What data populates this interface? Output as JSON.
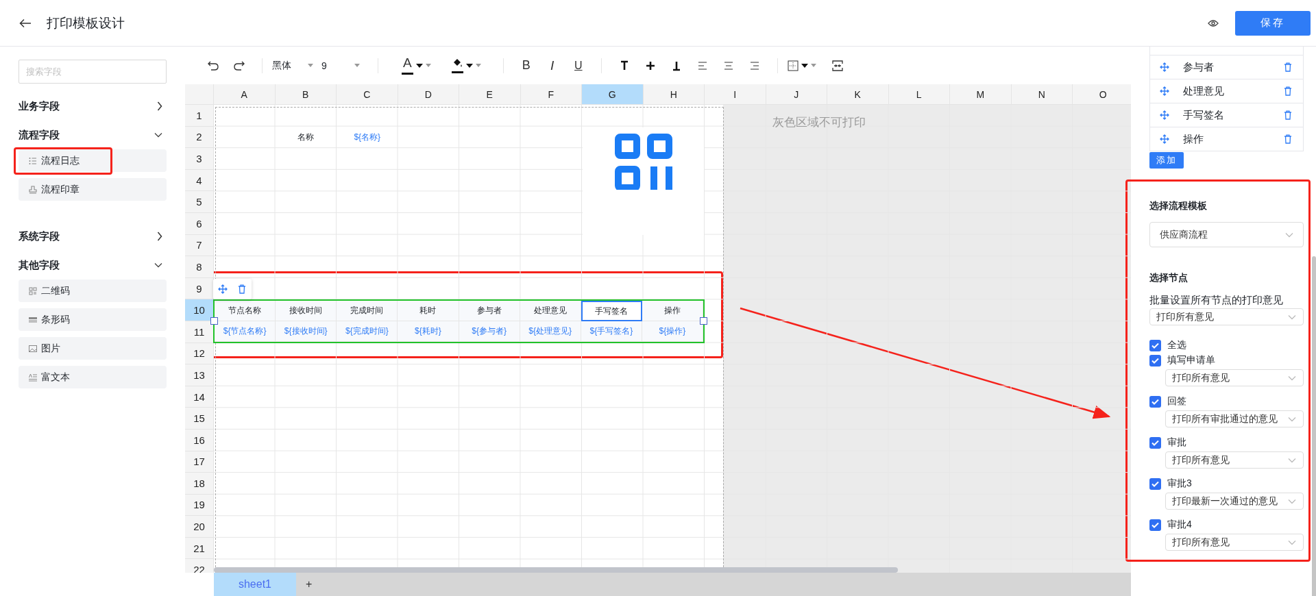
{
  "header": {
    "title": "打印模板设计",
    "save": "保存"
  },
  "sidebar": {
    "search": {
      "placeholder": "搜索字段"
    },
    "groups": [
      {
        "label": "业务字段",
        "expanded": false
      },
      {
        "label": "流程字段",
        "expanded": true,
        "items": [
          {
            "label": "流程日志",
            "kind": "list"
          },
          {
            "label": "流程印章",
            "kind": "stamp"
          }
        ]
      },
      {
        "label": "系统字段",
        "expanded": false
      },
      {
        "label": "其他字段",
        "expanded": true,
        "items": [
          {
            "label": "二维码",
            "kind": "qrcode"
          },
          {
            "label": "条形码",
            "kind": "barcode"
          },
          {
            "label": "图片",
            "kind": "image"
          },
          {
            "label": "富文本",
            "kind": "richtext"
          }
        ]
      }
    ]
  },
  "toolbar": {
    "font": "黑体",
    "size": "9",
    "font_color": "A",
    "bold": "B",
    "italic": "I",
    "underline": "U"
  },
  "sheet": {
    "columns": [
      {
        "label": "A",
        "selected": false
      },
      {
        "label": "B",
        "selected": false
      },
      {
        "label": "C",
        "selected": false
      },
      {
        "label": "D",
        "selected": false
      },
      {
        "label": "E",
        "selected": false
      },
      {
        "label": "F",
        "selected": false
      },
      {
        "label": "G",
        "selected": true
      },
      {
        "label": "H",
        "selected": false
      },
      {
        "label": "I",
        "selected": false
      },
      {
        "label": "J",
        "selected": false
      },
      {
        "label": "K",
        "selected": false
      },
      {
        "label": "L",
        "selected": false
      },
      {
        "label": "M",
        "selected": false
      },
      {
        "label": "N",
        "selected": false
      },
      {
        "label": "O",
        "selected": false
      }
    ],
    "rows": [
      {
        "label": "1",
        "selected": false
      },
      {
        "label": "2",
        "selected": false
      },
      {
        "label": "3",
        "selected": false
      },
      {
        "label": "4",
        "selected": false
      },
      {
        "label": "5",
        "selected": false
      },
      {
        "label": "6",
        "selected": false
      },
      {
        "label": "7",
        "selected": false
      },
      {
        "label": "8",
        "selected": false
      },
      {
        "label": "9",
        "selected": false
      },
      {
        "label": "10",
        "selected": true
      },
      {
        "label": "11",
        "selected": false
      },
      {
        "label": "12",
        "selected": false
      },
      {
        "label": "13",
        "selected": false
      },
      {
        "label": "14",
        "selected": false
      },
      {
        "label": "15",
        "selected": false
      },
      {
        "label": "16",
        "selected": false
      },
      {
        "label": "17",
        "selected": false
      },
      {
        "label": "18",
        "selected": false
      },
      {
        "label": "19",
        "selected": false
      },
      {
        "label": "20",
        "selected": false
      },
      {
        "label": "21",
        "selected": false
      },
      {
        "label": "22",
        "selected": false
      }
    ],
    "name_label": "名称",
    "name_field": "${名称}",
    "print_note": "灰色区域不可打印",
    "log_table": [
      {
        "header": "节点名称",
        "field": "${节点名称}",
        "selected": false
      },
      {
        "header": "接收时间",
        "field": "${接收时间}",
        "selected": false
      },
      {
        "header": "完成时间",
        "field": "${完成时间}",
        "selected": false
      },
      {
        "header": "耗时",
        "field": "${耗时}",
        "selected": false
      },
      {
        "header": "参与者",
        "field": "${参与者}",
        "selected": false
      },
      {
        "header": "处理意见",
        "field": "${处理意见}",
        "selected": false
      },
      {
        "header": "手写签名",
        "field": "${手写签名}",
        "selected": true
      },
      {
        "header": "操作",
        "field": "${操作}",
        "selected": false
      }
    ]
  },
  "sheet_tabs": {
    "tabs": [
      {
        "label": "sheet1",
        "selected": true
      }
    ],
    "add": "+"
  },
  "panel": {
    "fields": [
      {
        "label": "参与者"
      },
      {
        "label": "处理意见"
      },
      {
        "label": "手写签名"
      },
      {
        "label": "操作"
      }
    ],
    "add": "添加",
    "template": {
      "label": "选择流程模板",
      "value": "供应商流程"
    },
    "nodes_label": "选择节点",
    "batch": {
      "label": "批量设置所有节点的打印意见",
      "value": "打印所有意见"
    },
    "select_all": {
      "label": "全选",
      "checked": true
    },
    "nodes": [
      {
        "label": "填写申请单",
        "checked": true,
        "option": "打印所有意见"
      },
      {
        "label": "回签",
        "checked": true,
        "option": "打印所有审批通过的意见"
      },
      {
        "label": "审批",
        "checked": true,
        "option": "打印所有意见"
      },
      {
        "label": "审批3",
        "checked": true,
        "option": "打印最新一次通过的意见"
      },
      {
        "label": "审批4",
        "checked": true,
        "option": "打印所有意见"
      }
    ]
  }
}
